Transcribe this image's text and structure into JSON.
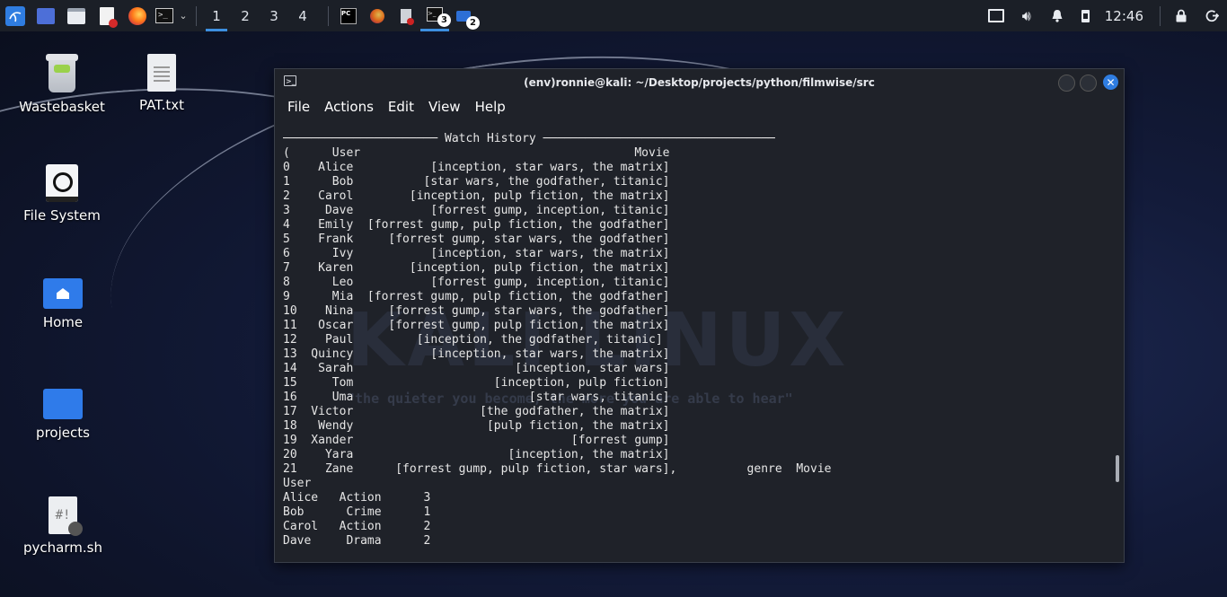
{
  "panel": {
    "workspaces": [
      "1",
      "2",
      "3",
      "4"
    ],
    "terminal_badge": "3",
    "files_badge": "2",
    "clock": "12:46"
  },
  "desktop": {
    "icons": [
      {
        "label": "Wastebasket",
        "icon": "trash-icon"
      },
      {
        "label": "PAT.txt",
        "icon": "text-file-icon"
      },
      {
        "label": "File System",
        "icon": "drive-icon"
      },
      {
        "label": "Home",
        "icon": "home-folder-icon"
      },
      {
        "label": "projects",
        "icon": "folder-icon"
      },
      {
        "label": "pycharm.sh",
        "icon": "script-file-icon"
      }
    ],
    "watermark": "KALI LINUX",
    "tagline": "\"the quieter you become, the more you are able to hear\""
  },
  "window": {
    "title": "(env)ronnie@kali: ~/Desktop/projects/python/filmwise/src",
    "menu": [
      "File",
      "Actions",
      "Edit",
      "View",
      "Help"
    ]
  },
  "terminal": {
    "lines": [
      "────────────────────── Watch History ─────────────────────────────────",
      "(      User                                       Movie",
      "0    Alice           [inception, star wars, the matrix]",
      "1      Bob          [star wars, the godfather, titanic]",
      "2    Carol        [inception, pulp fiction, the matrix]",
      "3     Dave           [forrest gump, inception, titanic]",
      "4    Emily  [forrest gump, pulp fiction, the godfather]",
      "5    Frank     [forrest gump, star wars, the godfather]",
      "6      Ivy           [inception, star wars, the matrix]",
      "7    Karen        [inception, pulp fiction, the matrix]",
      "8      Leo           [forrest gump, inception, titanic]",
      "9      Mia  [forrest gump, pulp fiction, the godfather]",
      "10    Nina     [forrest gump, star wars, the godfather]",
      "11   Oscar     [forrest gump, pulp fiction, the matrix]",
      "12    Paul         [inception, the godfather, titanic]",
      "13  Quincy           [inception, star wars, the matrix]",
      "14   Sarah                       [inception, star wars]",
      "15     Tom                    [inception, pulp fiction]",
      "16     Uma                         [star wars, titanic]",
      "17  Victor                  [the godfather, the matrix]",
      "18   Wendy                   [pulp fiction, the matrix]",
      "19  Xander                               [forrest gump]",
      "20    Yara                      [inception, the matrix]",
      "21    Zane      [forrest gump, pulp fiction, star wars],          genre  Movie",
      "User",
      "Alice   Action      3",
      "Bob      Crime      1",
      "Carol   Action      2",
      "Dave     Drama      2"
    ]
  }
}
